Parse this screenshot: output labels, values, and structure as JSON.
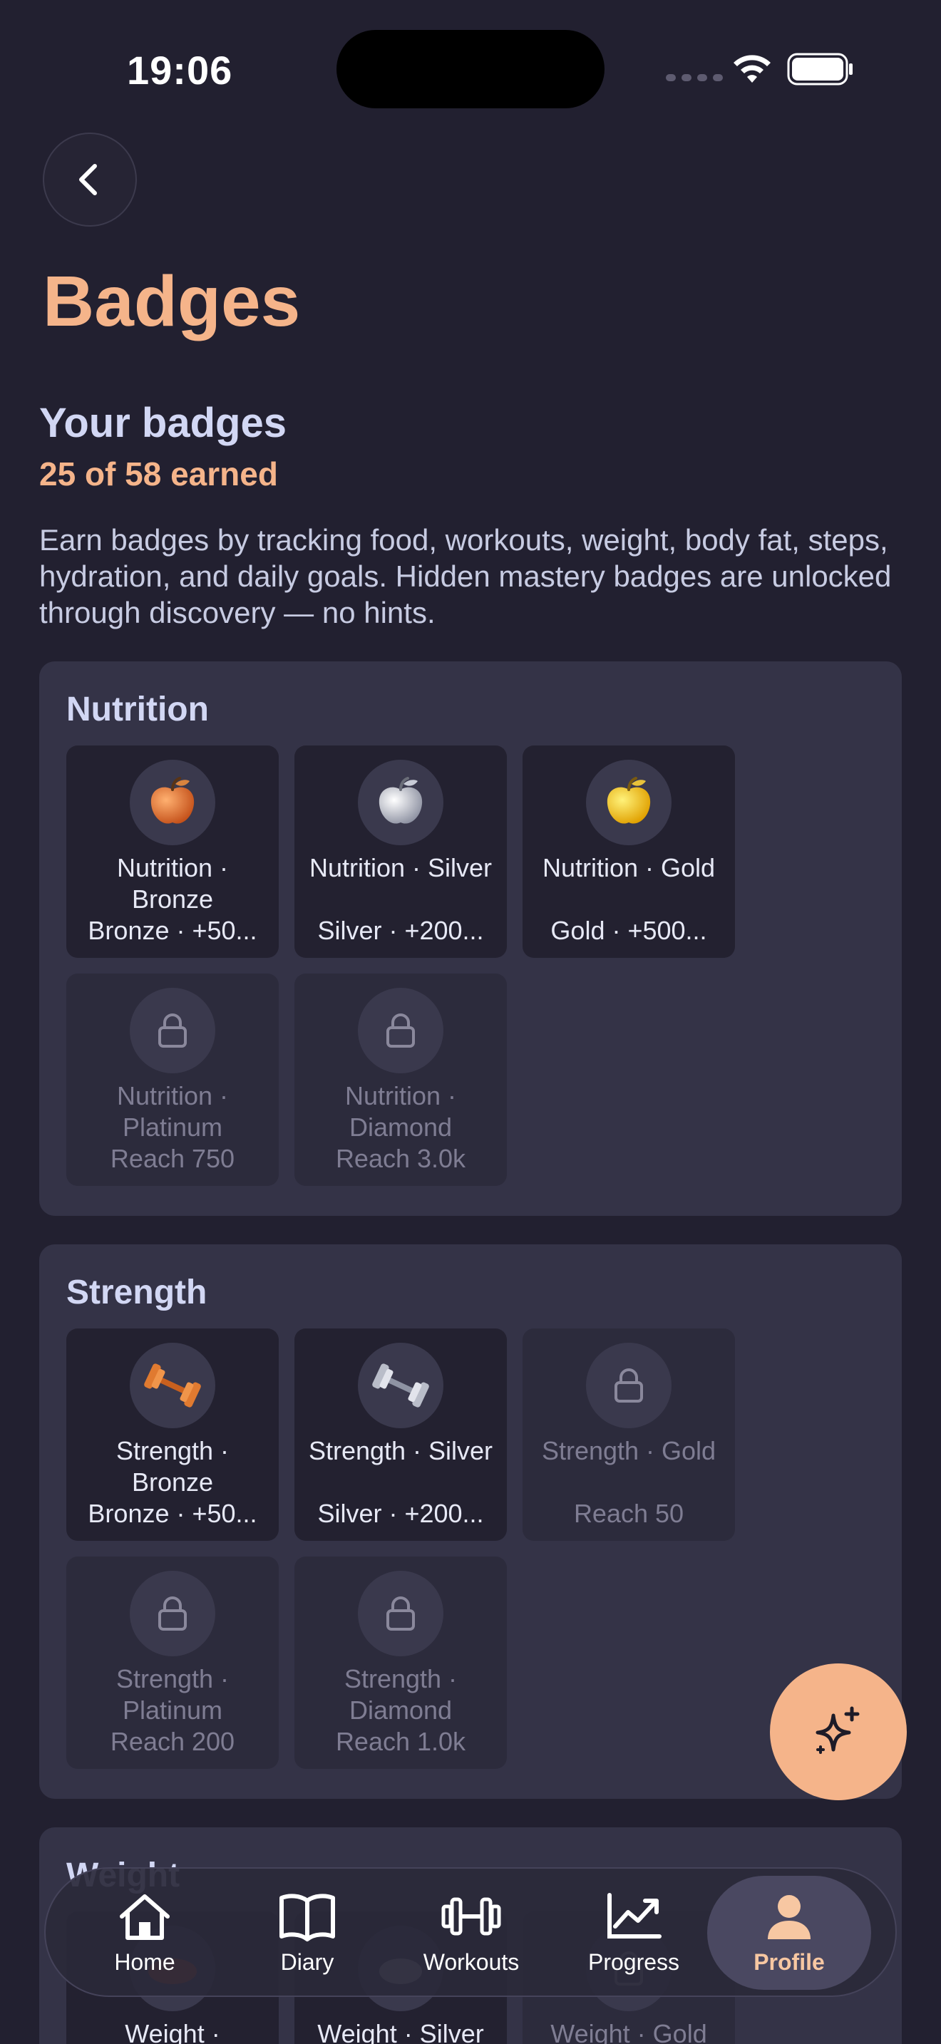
{
  "status_bar": {
    "time": "19:06"
  },
  "header": {
    "title": "Badges"
  },
  "summary": {
    "title": "Your badges",
    "earned": "25 of 58 earned",
    "description": "Earn badges by tracking food, workouts, weight, body fat, steps, hydration, and daily goals. Hidden mastery badges are unlocked through discovery — no hints."
  },
  "categories": [
    {
      "title": "Nutrition",
      "badges": [
        {
          "name": "Nutrition · Bronze",
          "sub": "Bronze · +50...",
          "icon": "bronze-apple-icon",
          "locked": false
        },
        {
          "name": "Nutrition · Silver",
          "sub": "Silver · +200...",
          "icon": "silver-apple-icon",
          "locked": false
        },
        {
          "name": "Nutrition · Gold",
          "sub": "Gold · +500...",
          "icon": "gold-apple-icon",
          "locked": false
        },
        {
          "name": "Nutrition · Platinum",
          "sub": "Reach 750",
          "icon": "lock-icon",
          "locked": true
        },
        {
          "name": "Nutrition · Diamond",
          "sub": "Reach 3.0k",
          "icon": "lock-icon",
          "locked": true
        }
      ]
    },
    {
      "title": "Strength",
      "badges": [
        {
          "name": "Strength · Bronze",
          "sub": "Bronze · +50...",
          "icon": "bronze-dumbbell-icon",
          "locked": false
        },
        {
          "name": "Strength · Silver",
          "sub": "Silver · +200...",
          "icon": "silver-dumbbell-icon",
          "locked": false
        },
        {
          "name": "Strength · Gold",
          "sub": "Reach 50",
          "icon": "lock-icon",
          "locked": true
        },
        {
          "name": "Strength · Platinum",
          "sub": "Reach 200",
          "icon": "lock-icon",
          "locked": true
        },
        {
          "name": "Strength · Diamond",
          "sub": "Reach 1.0k",
          "icon": "lock-icon",
          "locked": true
        }
      ]
    },
    {
      "title": "Weight",
      "badges": [
        {
          "name": "Weight ·",
          "sub": "",
          "icon": "bronze-scale-icon",
          "locked": false
        },
        {
          "name": "Weight · Silver",
          "sub": "",
          "icon": "silver-scale-icon",
          "locked": false
        },
        {
          "name": "Weight · Gold",
          "sub": "",
          "icon": "lock-icon",
          "locked": true
        }
      ]
    }
  ],
  "fab": {
    "icon": "sparkle-icon"
  },
  "tabbar": {
    "tabs": [
      {
        "label": "Home",
        "icon": "home-icon"
      },
      {
        "label": "Diary",
        "icon": "book-icon"
      },
      {
        "label": "Workouts",
        "icon": "dumbbell-icon"
      },
      {
        "label": "Progress",
        "icon": "chart-icon"
      },
      {
        "label": "Profile",
        "icon": "person-icon"
      }
    ],
    "active": "Profile"
  },
  "colors": {
    "background": "#222030",
    "accent": "#f5b48a",
    "card": "#343347",
    "badge_tile": "#232130"
  }
}
